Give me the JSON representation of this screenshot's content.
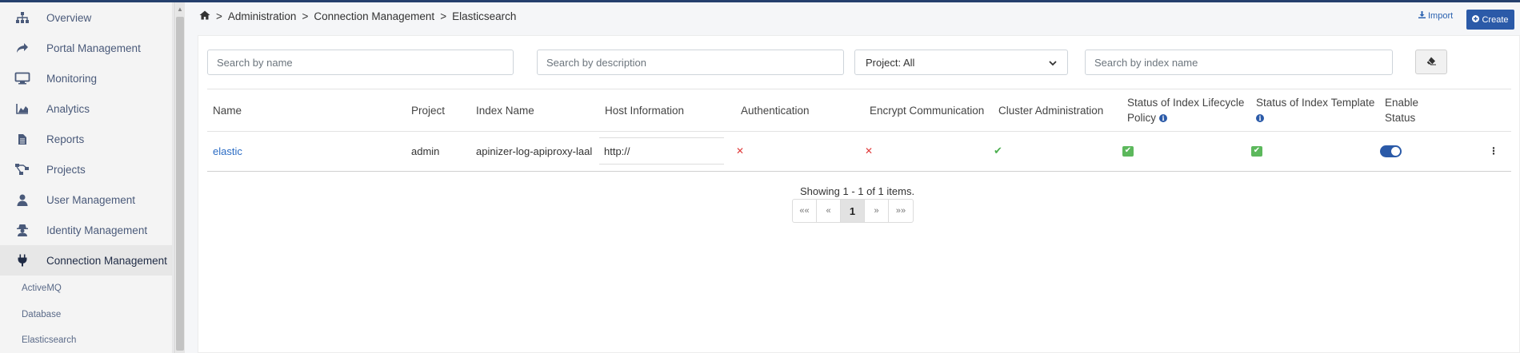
{
  "sidebar": {
    "items": [
      {
        "label": "Overview",
        "icon": "sitemap-icon"
      },
      {
        "label": "Portal Management",
        "icon": "share-icon"
      },
      {
        "label": "Monitoring",
        "icon": "desktop-icon"
      },
      {
        "label": "Analytics",
        "icon": "area-chart-icon"
      },
      {
        "label": "Reports",
        "icon": "file-icon"
      },
      {
        "label": "Projects",
        "icon": "project-diagram-icon"
      },
      {
        "label": "User Management",
        "icon": "user-icon"
      },
      {
        "label": "Identity Management",
        "icon": "user-secret-icon"
      },
      {
        "label": "Connection Management",
        "icon": "plug-icon",
        "active": true
      }
    ],
    "subitems": [
      "ActiveMQ",
      "Database",
      "Elasticsearch"
    ]
  },
  "breadcrumb": {
    "home_icon": "home-icon",
    "items": [
      "Administration",
      "Connection Management",
      "Elasticsearch"
    ],
    "separator": ">"
  },
  "actions": {
    "import_label": "Import",
    "create_label": "Create"
  },
  "filters": {
    "name_placeholder": "Search by name",
    "description_placeholder": "Search by description",
    "project_select": "Project: All",
    "index_placeholder": "Search by index name"
  },
  "table": {
    "headers": {
      "name": "Name",
      "project": "Project",
      "index_name": "Index Name",
      "host": "Host Information",
      "auth": "Authentication",
      "encrypt": "Encrypt Communication",
      "cluster": "Cluster Administration",
      "ilm_line1": "Status of Index Lifecycle",
      "ilm_line2": "Policy",
      "template_line1": "Status of Index Template",
      "enable_line1": "Enable",
      "enable_line2": "Status"
    },
    "rows": [
      {
        "name": "elastic",
        "project": "admin",
        "index_name": "apinizer-log-apiproxy-laal",
        "host": "http://",
        "authentication": false,
        "encrypt": false,
        "cluster": true,
        "ilm_status": true,
        "template_status": true,
        "enabled": true
      }
    ]
  },
  "pagination": {
    "summary": "Showing 1 - 1 of 1 items.",
    "first": "««",
    "prev": "«",
    "current": "1",
    "next": "»",
    "last": "»»"
  },
  "colors": {
    "primary": "#2b5aa8",
    "link": "#2b6cc4",
    "danger": "#e03b3b",
    "success": "#5cb85c",
    "topbar": "#25406d"
  }
}
